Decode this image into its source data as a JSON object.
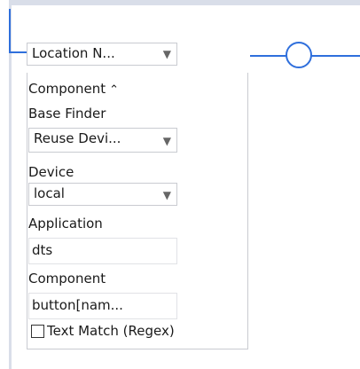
{
  "location": {
    "selected": "Location N..."
  },
  "panel": {
    "component_header": "Component",
    "base_finder_label": "Base Finder",
    "base_finder_value": "Reuse Devi...",
    "device_label": "Device",
    "device_value": "local",
    "application_label": "Application",
    "application_value": "dts",
    "component_label": "Component",
    "component_value": "button[nam...",
    "text_match_label": "Text Match (Regex)",
    "text_match_checked": false
  },
  "icons": {
    "dropdown": "triangle-down-icon",
    "collapse": "chevron-up-icon",
    "connector": "circle-node-icon"
  },
  "colors": {
    "accent": "#2f6fdc",
    "rail": "#d9dee9",
    "border": "#c9cbd1"
  }
}
